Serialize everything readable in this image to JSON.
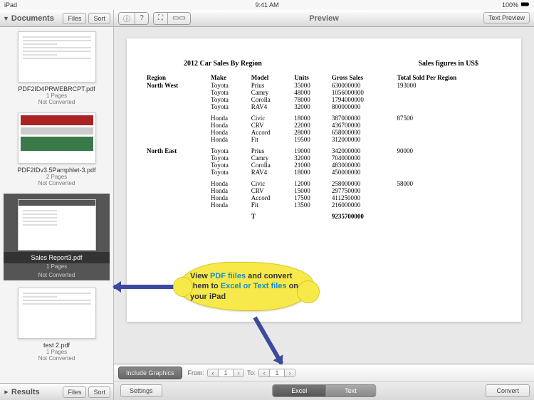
{
  "statusbar": {
    "carrier": "iPad",
    "time": "9:41 AM",
    "battery": "100%"
  },
  "sidebar": {
    "header": {
      "title": "Documents",
      "files_btn": "Files",
      "sort_btn": "Sort"
    },
    "footer": {
      "title": "Results",
      "files_btn": "Files",
      "sort_btn": "Sort"
    },
    "docs": [
      {
        "name": "PDF2ID4PRWEBRCPT.pdf",
        "pages": "1 Pages",
        "status": "Not Converted"
      },
      {
        "name": "PDF2IDv3.5Pamphlet-3.pdf",
        "pages": "2 Pages",
        "status": "Not Converted"
      },
      {
        "name": "Sales Report3.pdf",
        "pages": "1 Pages",
        "status": "Not Converted"
      },
      {
        "name": "test 2.pdf",
        "pages": "1 Pages",
        "status": "Not Converted"
      }
    ]
  },
  "toolbar": {
    "preview_title": "Preview",
    "text_preview_btn": "Text Preview"
  },
  "bottombar": {
    "include_graphics": "Include Graphics",
    "from_label": "From:",
    "from_value": "1",
    "to_label": "To:",
    "to_value": "1",
    "settings_btn": "Settings",
    "excel_opt": "Excel",
    "text_opt": "Text",
    "convert_btn": "Convert"
  },
  "callout": {
    "t1": "View ",
    "h1": "PDF fiiles",
    "t2": " and convert them to ",
    "h2": "Excel or Text files",
    "t3": " on your iPad"
  },
  "chart_data": {
    "type": "table",
    "title": "2012 Car Sales By Region",
    "subtitle": "Sales figures in US$",
    "columns": [
      "Region",
      "Make",
      "Model",
      "Units",
      "Gross Sales",
      "Total Sold Per Region"
    ],
    "rows": [
      {
        "region": "North West",
        "make": "Toyota",
        "model": "Prius",
        "units": 35000,
        "gross": 630000000,
        "region_total": 193000
      },
      {
        "region": "",
        "make": "Toyota",
        "model": "Camry",
        "units": 48000,
        "gross": 1056000000,
        "region_total": ""
      },
      {
        "region": "",
        "make": "Toyota",
        "model": "Corolla",
        "units": 78000,
        "gross": 1794000000,
        "region_total": ""
      },
      {
        "region": "",
        "make": "Toyota",
        "model": "RAV4",
        "units": 32000,
        "gross": 800000000,
        "region_total": ""
      },
      {
        "gap": true
      },
      {
        "region": "",
        "make": "Honda",
        "model": "Civic",
        "units": 18000,
        "gross": 387000000,
        "region_total": 87500
      },
      {
        "region": "",
        "make": "Honda",
        "model": "CRV",
        "units": 22000,
        "gross": 436700000,
        "region_total": ""
      },
      {
        "region": "",
        "make": "Honda",
        "model": "Accord",
        "units": 28000,
        "gross": 658000000,
        "region_total": ""
      },
      {
        "region": "",
        "make": "Honda",
        "model": "Fit",
        "units": 19500,
        "gross": 312000000,
        "region_total": ""
      },
      {
        "gap": true
      },
      {
        "region": "North East",
        "make": "Toyota",
        "model": "Prius",
        "units": 19000,
        "gross": 342000000,
        "region_total": 90000
      },
      {
        "region": "",
        "make": "Toyota",
        "model": "Camry",
        "units": 32000,
        "gross": 704000000,
        "region_total": ""
      },
      {
        "region": "",
        "make": "Toyota",
        "model": "Corolla",
        "units": 21000,
        "gross": 483000000,
        "region_total": ""
      },
      {
        "region": "",
        "make": "Toyota",
        "model": "RAV4",
        "units": 18000,
        "gross": 450000000,
        "region_total": ""
      },
      {
        "gap": true
      },
      {
        "region": "",
        "make": "Honda",
        "model": "Civic",
        "units": 12000,
        "gross": 258000000,
        "region_total": 58000
      },
      {
        "region": "",
        "make": "Honda",
        "model": "CRV",
        "units": 15000,
        "gross": 297750000,
        "region_total": ""
      },
      {
        "region": "",
        "make": "Honda",
        "model": "Accord",
        "units": 17500,
        "gross": 411250000,
        "region_total": ""
      },
      {
        "region": "",
        "make": "Honda",
        "model": "Fit",
        "units": 13500,
        "gross": 216000000,
        "region_total": ""
      }
    ],
    "total_label": "T",
    "grand_total": 9235700000
  }
}
